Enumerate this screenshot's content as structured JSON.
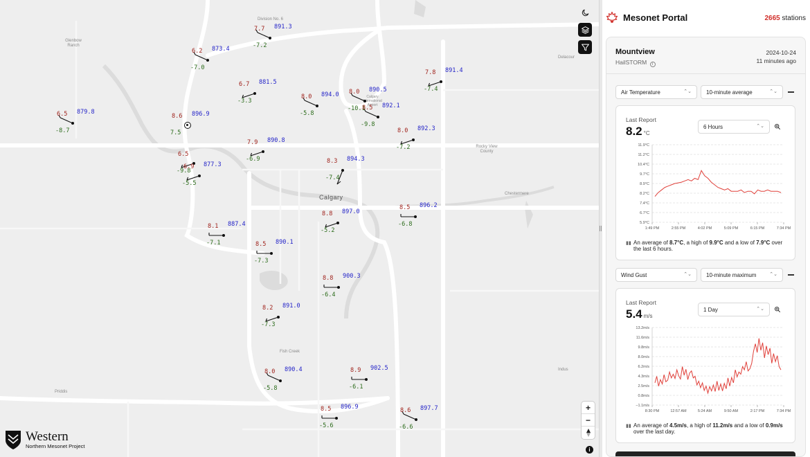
{
  "header": {
    "title": "Mesonet Portal",
    "count": "2665",
    "count_label": " stations"
  },
  "station": {
    "name": "Mountview",
    "network": "HailSTORM",
    "date": "2024-10-24",
    "ago": "11 minutes ago"
  },
  "panels": [
    {
      "variable": "Air Temperature",
      "aggregation": "10-minute average",
      "last_report_label": "Last Report",
      "value": "8.2",
      "unit": "°C",
      "range": "6 Hours",
      "summary_pre": "An average of ",
      "avg": "8.7°C",
      "mid1": ", a high of ",
      "high": "9.9°C",
      "mid2": " and a low of ",
      "low": "7.9°C",
      "post": " over the last 6 hours.",
      "chart_data": {
        "type": "line",
        "y_ticks": [
          "11.9°C",
          "11.2°C",
          "10.4°C",
          "9.7°C",
          "8.9°C",
          "8.2°C",
          "7.4°C",
          "6.7°C",
          "5.9°C"
        ],
        "x_ticks": [
          "1:49 PM",
          "2:55 PM",
          "4:02 PM",
          "5:09 PM",
          "6:15 PM",
          "7:34 PM"
        ],
        "ylim": [
          5.9,
          11.9
        ],
        "values": [
          7.9,
          8.2,
          8.4,
          8.6,
          8.7,
          8.8,
          8.9,
          8.95,
          9.0,
          9.1,
          9.2,
          9.1,
          9.3,
          9.2,
          9.9,
          9.5,
          9.3,
          9.0,
          8.8,
          8.6,
          8.5,
          8.4,
          8.5,
          8.3,
          8.3,
          8.3,
          8.4,
          8.2,
          8.3,
          8.3,
          8.1,
          8.4,
          8.3,
          8.3,
          8.4,
          8.3,
          8.3,
          8.3,
          8.2
        ]
      }
    },
    {
      "variable": "Wind Gust",
      "aggregation": "10-minute maximum",
      "last_report_label": "Last Report",
      "value": "5.4",
      "unit": "m/s",
      "range": "1 Day",
      "summary_pre": "An average of ",
      "avg": "4.5m/s",
      "mid1": ", a high of ",
      "high": "11.2m/s",
      "mid2": " and a low of ",
      "low": "0.9m/s",
      "post": " over the last day.",
      "chart_data": {
        "type": "line",
        "y_ticks": [
          "13.2m/s",
          "11.6m/s",
          "9.8m/s",
          "8.0m/s",
          "6.2m/s",
          "4.3m/s",
          "2.5m/s",
          "0.8m/s",
          "−1.1m/s"
        ],
        "x_ticks": [
          "8:30 PM",
          "12:57 AM",
          "5:24 AM",
          "9:50 AM",
          "2:17 PM",
          "7:34 PM"
        ],
        "ylim": [
          -1.1,
          13.2
        ],
        "values": [
          3.0,
          4.2,
          2.4,
          3.6,
          2.8,
          4.5,
          3.2,
          3.5,
          5.0,
          3.9,
          4.6,
          3.8,
          5.4,
          4.3,
          3.7,
          6.0,
          4.4,
          5.5,
          3.6,
          4.8,
          5.2,
          3.9,
          4.2,
          2.6,
          3.3,
          2.1,
          3.0,
          1.6,
          2.4,
          1.1,
          2.3,
          1.5,
          2.6,
          1.4,
          3.3,
          1.6,
          2.8,
          1.5,
          2.9,
          1.9,
          3.9,
          2.4,
          4.0,
          3.0,
          5.4,
          4.1,
          5.0,
          4.6,
          6.0,
          5.4,
          6.9,
          5.2,
          5.6,
          6.6,
          8.8,
          10.2,
          8.6,
          11.2,
          9.0,
          10.4,
          7.6,
          9.8,
          8.2,
          9.4,
          6.6,
          8.4,
          6.9,
          8.0,
          6.0,
          5.4
        ]
      }
    }
  ],
  "map": {
    "labels": {
      "division": "Division No. 6",
      "glenbow": "Glenbow Ranch",
      "delacour": "Delacour",
      "rockyview": "Rocky View County",
      "chestermere": "Chestermere",
      "calgary": "Calgary",
      "fishcreek": "Fish Creek",
      "indus": "Indus",
      "priddis": "Priddis",
      "airport": "Calgary International Airport"
    },
    "stations": [
      {
        "t": "7.7",
        "d": "-7.2",
        "p": "891.3"
      },
      {
        "t": "6.2",
        "d": "-7.0",
        "p": "873.4"
      },
      {
        "t": "6.7",
        "d": "-3.3",
        "p": "881.5"
      },
      {
        "t": "8.0",
        "d": "-5.8",
        "p": "894.0"
      },
      {
        "t": "8.0",
        "d": "-10.1",
        "p": "890.5"
      },
      {
        "t": "8.5",
        "d": "-9.8",
        "p": "892.1"
      },
      {
        "t": "7.8",
        "d": "-7.4",
        "p": "891.4"
      },
      {
        "t": "6.5",
        "d": "-8.7",
        "p": "879.8"
      },
      {
        "t": "8.6",
        "d": "7.5",
        "p": "896.9"
      },
      {
        "t": "8.0",
        "d": "-7.2",
        "p": "892.3"
      },
      {
        "t": "7.9",
        "d": "-6.9",
        "p": "890.8"
      },
      {
        "t": "6.5",
        "d": "-9.8",
        "p": ""
      },
      {
        "t": "6.9",
        "d": "-5.5",
        "p": "877.3"
      },
      {
        "t": "8.3",
        "d": "-7.4",
        "p": "894.3"
      },
      {
        "t": "8.5",
        "d": "-6.8",
        "p": "896.2"
      },
      {
        "t": "8.8",
        "d": "-5.2",
        "p": "897.0"
      },
      {
        "t": "8.1",
        "d": "-7.1",
        "p": "887.4"
      },
      {
        "t": "8.5",
        "d": "-7.3",
        "p": "890.1"
      },
      {
        "t": "8.8",
        "d": "-6.4",
        "p": "900.3"
      },
      {
        "t": "8.2",
        "d": "-7.3",
        "p": "891.0"
      },
      {
        "t": "8.0",
        "d": "-5.8",
        "p": "890.4"
      },
      {
        "t": "8.9",
        "d": "-6.1",
        "p": "902.5"
      },
      {
        "t": "8.5",
        "d": "-5.6",
        "p": "896.9"
      },
      {
        "t": "8.6",
        "d": "-6.6",
        "p": "897.7"
      }
    ]
  },
  "logo": {
    "name": "Western",
    "subtitle": "Northern Mesonet Project"
  },
  "colors": {
    "accent": "#d1302b",
    "temp": "#a0231c",
    "dew": "#2b6b1a",
    "pressure": "#2323c8"
  }
}
